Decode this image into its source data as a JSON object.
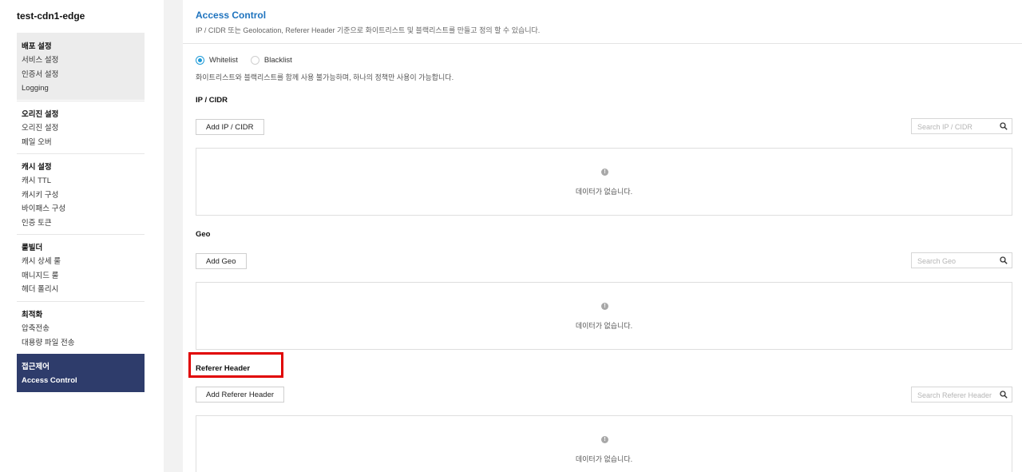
{
  "app": {
    "title": "test-cdn1-edge"
  },
  "sidebar": {
    "groups": [
      {
        "heading": "배포 설정",
        "items": [
          "서비스 설정",
          "인증서 설정",
          "Logging"
        ]
      },
      {
        "heading": "오리진 설정",
        "items": [
          "오리진 설정",
          "페일 오버"
        ]
      },
      {
        "heading": "캐시 설정",
        "items": [
          "캐시 TTL",
          "캐시키 구성",
          "바이패스 구성",
          "인증 토큰"
        ]
      },
      {
        "heading": "룰빌더",
        "items": [
          "캐시 상세 룰",
          "매니지드 룰",
          "헤더 폴리시"
        ]
      },
      {
        "heading": "최적화",
        "items": [
          "압축전송",
          "대용량 파일 전송"
        ]
      },
      {
        "heading": "접근제어",
        "items": [
          "Access Control"
        ]
      }
    ]
  },
  "main": {
    "title": "Access Control",
    "description": "IP / CIDR 또는 Geolocation, Referer Header 기준으로 화이트리스트 및 블랙리스트를 만들고 정의 할 수 있습니다.",
    "mode": {
      "options": [
        "Whitelist",
        "Blacklist"
      ],
      "selected": "Whitelist",
      "note": "화이트리스트와 블랙리스트를 함께 사용 불가능하며, 하나의 정책만 사용이 가능합니다."
    },
    "sections": [
      {
        "title": "IP / CIDR",
        "button": "Add IP / CIDR",
        "search_placeholder": "Search IP / CIDR",
        "empty_icon": "info-icon",
        "empty_text": "데이터가 없습니다."
      },
      {
        "title": "Geo",
        "button": "Add Geo",
        "search_placeholder": "Search Geo",
        "empty_icon": "info-icon",
        "empty_text": "데이터가 없습니다."
      },
      {
        "title": "Referer Header",
        "button": "Add Referer Header",
        "search_placeholder": "Search Referer Header",
        "empty_icon": "info-icon",
        "empty_text": "데이터가 없습니다."
      }
    ]
  },
  "colors": {
    "accent": "#1e73be",
    "active_nav": "#2e3c6b",
    "radio": "#1f9bd8",
    "highlight": "#e00000"
  }
}
